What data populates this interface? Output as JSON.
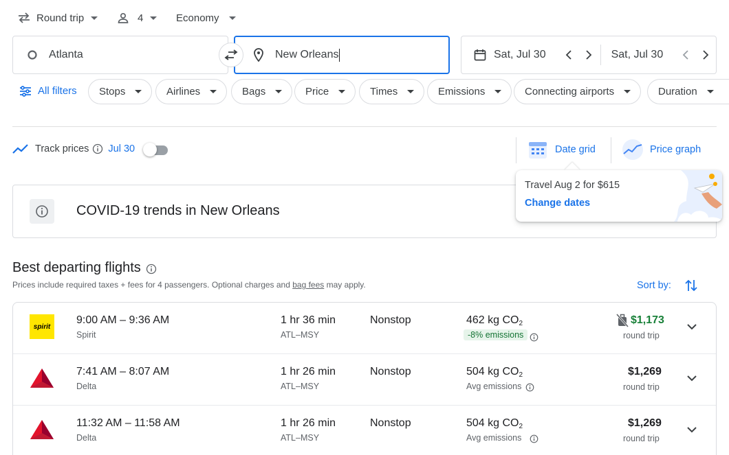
{
  "trip_type": "Round trip",
  "passengers": "4",
  "cabin": "Economy",
  "origin": "Atlanta",
  "destination": "New Orleans",
  "depart_date": "Sat, Jul 30",
  "return_date": "Sat, Jul 30",
  "filters": {
    "all": "All filters",
    "chips": [
      "Stops",
      "Airlines",
      "Bags",
      "Price",
      "Times",
      "Emissions",
      "Connecting airports",
      "Duration"
    ]
  },
  "track": {
    "label": "Track prices",
    "date": "Jul 30",
    "enabled": false
  },
  "views": {
    "date_grid": "Date grid",
    "price_graph": "Price graph"
  },
  "popup": {
    "text": "Travel Aug 2 for $615",
    "link": "Change dates"
  },
  "covid": {
    "text": "COVID-19 trends in New Orleans"
  },
  "section": {
    "title": "Best departing flights",
    "subtitle_pre": "Prices include required taxes + fees for 4 passengers. Optional charges and ",
    "subtitle_link": "bag fees",
    "subtitle_post": " may apply.",
    "sort": "Sort by:"
  },
  "flights": [
    {
      "times": "9:00 AM – 9:36 AM",
      "airline": "Spirit",
      "duration": "1 hr 36 min",
      "route": "ATL–MSY",
      "stops": "Nonstop",
      "co2": "462 kg CO",
      "co2_sub": "2",
      "emissions": "-8% emissions",
      "price": "$1,173",
      "price_note": "round trip",
      "logo": "spirit"
    },
    {
      "times": "7:41 AM – 8:07 AM",
      "airline": "Delta",
      "duration": "1 hr 26 min",
      "route": "ATL–MSY",
      "stops": "Nonstop",
      "co2": "504 kg CO",
      "co2_sub": "2",
      "emissions": "Avg emissions",
      "price": "$1,269",
      "price_note": "round trip",
      "logo": "delta"
    },
    {
      "times": "11:32 AM – 11:58 AM",
      "airline": "Delta",
      "duration": "1 hr 26 min",
      "route": "ATL–MSY",
      "stops": "Nonstop",
      "co2": "504 kg CO",
      "co2_sub": "2",
      "emissions": "Avg emissions",
      "price": "$1,269",
      "price_note": "round trip",
      "logo": "delta"
    }
  ],
  "colors": {
    "accent": "#1a73e8",
    "price_low": "#188038",
    "emission_bg": "#e6f4ea",
    "spirit_yellow": "#ffe600",
    "delta_red": "#c01933"
  }
}
